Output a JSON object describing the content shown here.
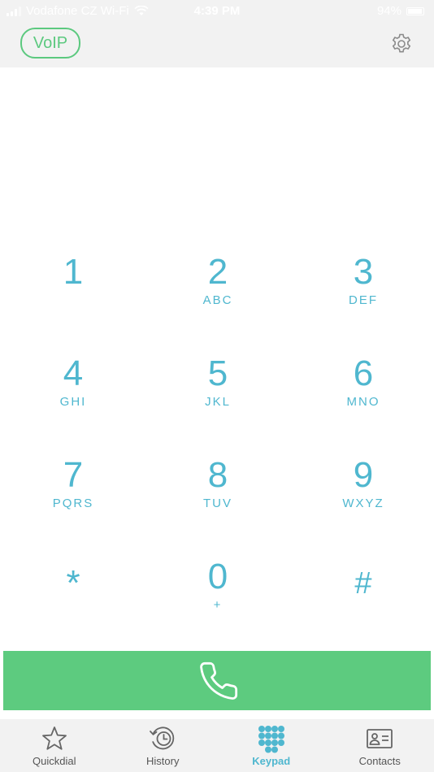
{
  "status_bar": {
    "carrier": "Vodafone CZ Wi-Fi",
    "time": "4:39 PM",
    "battery": "94%",
    "battery_level": 0.94
  },
  "header": {
    "voip_label": "VoIP",
    "settings_icon": "gear-icon"
  },
  "display": {
    "number": ""
  },
  "keypad": {
    "keys": [
      {
        "digit": "1",
        "letters": ""
      },
      {
        "digit": "2",
        "letters": "ABC"
      },
      {
        "digit": "3",
        "letters": "DEF"
      },
      {
        "digit": "4",
        "letters": "GHI"
      },
      {
        "digit": "5",
        "letters": "JKL"
      },
      {
        "digit": "6",
        "letters": "MNO"
      },
      {
        "digit": "7",
        "letters": "PQRS"
      },
      {
        "digit": "8",
        "letters": "TUV"
      },
      {
        "digit": "9",
        "letters": "WXYZ"
      },
      {
        "digit": "*",
        "letters": ""
      },
      {
        "digit": "0",
        "letters": "+"
      },
      {
        "digit": "#",
        "letters": ""
      }
    ]
  },
  "call_button": {
    "icon": "phone-icon"
  },
  "tabs": [
    {
      "label": "Quickdial",
      "icon": "star-icon",
      "active": false
    },
    {
      "label": "History",
      "icon": "history-icon",
      "active": false
    },
    {
      "label": "Keypad",
      "icon": "keypad-icon",
      "active": true
    },
    {
      "label": "Contacts",
      "icon": "contact-card-icon",
      "active": false
    }
  ],
  "colors": {
    "accent_green": "#5dcb7f",
    "accent_blue": "#4fb7cf",
    "bar_gray": "#f2f2f2"
  }
}
